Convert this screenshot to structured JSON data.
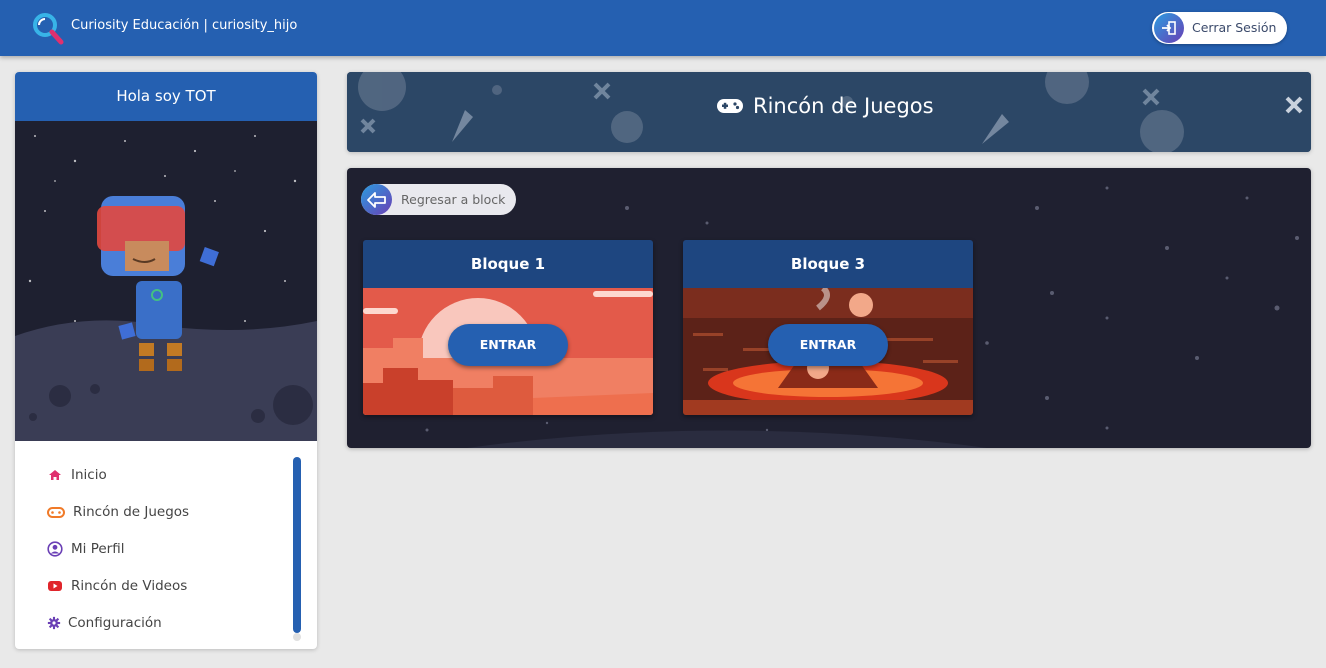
{
  "header": {
    "brand_text": "Curiosity Educación | curiosity_hijo",
    "logout_label": "Cerrar Sesión"
  },
  "sidebar": {
    "greeting": "Hola soy TOT",
    "items": [
      {
        "label": "Inicio",
        "icon": "home-icon",
        "color": "#e0306e"
      },
      {
        "label": "Rincón de Juegos",
        "icon": "gamepad-icon",
        "color": "#f07a28"
      },
      {
        "label": "Mi Perfil",
        "icon": "user-circle-icon",
        "color": "#6a3fb5"
      },
      {
        "label": "Rincón de Videos",
        "icon": "youtube-icon",
        "color": "#e0252b"
      },
      {
        "label": "Configuración",
        "icon": "gear-icon",
        "color": "#6a3fb5"
      }
    ]
  },
  "banner": {
    "title": "Rincón de Juegos"
  },
  "panel": {
    "back_label": "Regresar a block",
    "cards": [
      {
        "title": "Bloque 1",
        "button": "ENTRAR"
      },
      {
        "title": "Bloque 3",
        "button": "ENTRAR"
      }
    ]
  },
  "colors": {
    "primary": "#2560b1",
    "card_header": "#1e4680",
    "panel_bg": "#1f2030"
  }
}
